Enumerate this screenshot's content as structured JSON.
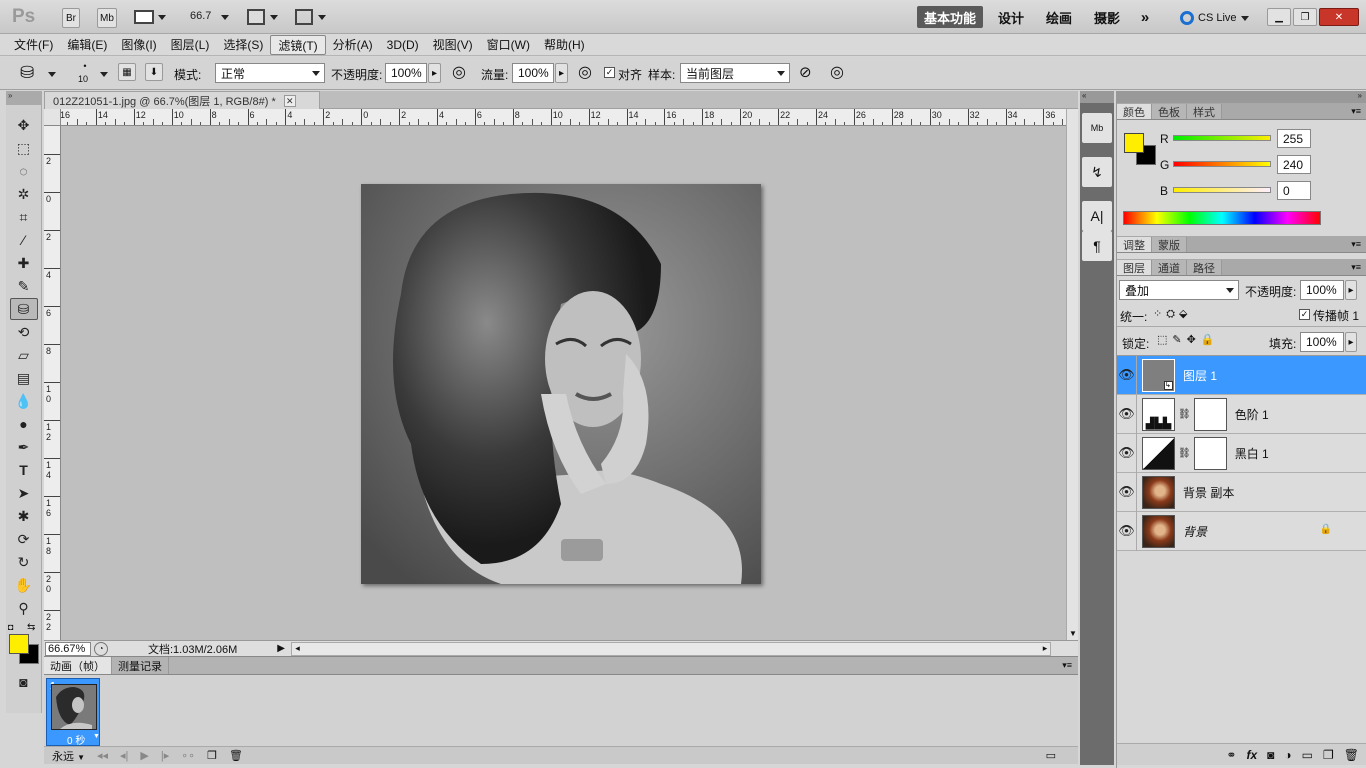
{
  "app": {
    "logo": "Ps",
    "bridge": "Br",
    "minibridge": "Mb",
    "zoom": "66.7"
  },
  "workspaces": [
    "基本功能",
    "设计",
    "绘画",
    "摄影"
  ],
  "cslive": "CS Live",
  "menu": [
    "文件(F)",
    "编辑(E)",
    "图像(I)",
    "图层(L)",
    "选择(S)",
    "滤镜(T)",
    "分析(A)",
    "3D(D)",
    "视图(V)",
    "窗口(W)",
    "帮助(H)"
  ],
  "options": {
    "brush_size": "10",
    "mode_label": "模式:",
    "mode_value": "正常",
    "opacity_label": "不透明度:",
    "opacity_value": "100%",
    "flow_label": "流量:",
    "flow_value": "100%",
    "align_label": "对齐",
    "sample_label": "样本:",
    "sample_value": "当前图层"
  },
  "document": {
    "tab_title": "012Z21051-1.jpg @ 66.7%(图层 1, RGB/8#) *",
    "ruler_h": [
      "16",
      "14",
      "12",
      "10",
      "8",
      "6",
      "4",
      "2",
      "0",
      "2",
      "4",
      "6",
      "8",
      "10",
      "12",
      "14",
      "16",
      "18",
      "20",
      "22",
      "24",
      "26",
      "28",
      "30",
      "32",
      "34",
      "36"
    ],
    "ruler_v": [
      "2",
      "0",
      "2",
      "4",
      "6",
      "8",
      "1\n0",
      "1\n2",
      "1\n4",
      "1\n6",
      "1\n8",
      "2\n0",
      "2\n2"
    ],
    "zoom_status": "66.67%",
    "doc_size": "文档:1.03M/2.06M"
  },
  "animation": {
    "tabs": [
      "动画（帧）",
      "测量记录"
    ],
    "frame_number": "1",
    "frame_delay": "0 秒",
    "loop": "永远"
  },
  "color_panel": {
    "tabs": [
      "颜色",
      "色板",
      "样式"
    ],
    "r_label": "R",
    "r_value": "255",
    "g_label": "G",
    "g_value": "240",
    "b_label": "B",
    "b_value": "0",
    "foreground": "#ffee00",
    "background": "#000000"
  },
  "adjust_panel": {
    "tabs": [
      "调整",
      "蒙版"
    ]
  },
  "layers_panel": {
    "tabs": [
      "图层",
      "通道",
      "路径"
    ],
    "blend_mode": "叠加",
    "opacity_label": "不透明度:",
    "opacity_value": "100%",
    "unify_label": "统一:",
    "propagate_label": "传播帧 1",
    "lock_label": "锁定:",
    "fill_label": "填充:",
    "fill_value": "100%",
    "layers": [
      {
        "name": "图层 1",
        "type": "pixel-gray",
        "selected": true
      },
      {
        "name": "色阶 1",
        "type": "levels"
      },
      {
        "name": "黑白 1",
        "type": "bw"
      },
      {
        "name": "背景 副本",
        "type": "photo"
      },
      {
        "name": "背景",
        "type": "photo",
        "locked": true
      }
    ]
  }
}
